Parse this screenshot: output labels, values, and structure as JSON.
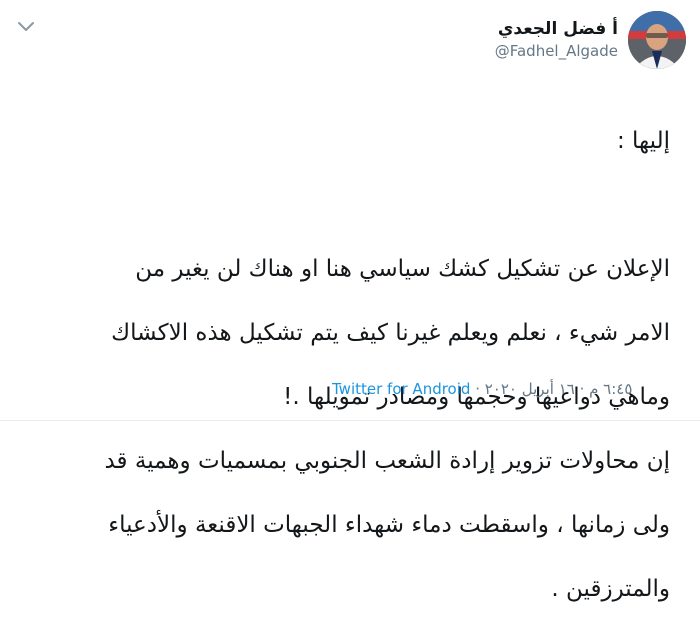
{
  "tweet": {
    "display_name": "أ فضل الجعدي",
    "handle": "@Fadhel_Algade",
    "lines": [
      "إليها :",
      "",
      "الإعلان عن تشكيل كشك سياسي هنا او هناك لن يغير من",
      "الامر شيء ، نعلم ويعلم غيرنا كيف يتم تشكيل هذه الاكشاك",
      "وماهي دواعيها وحجمها ومصادر تمويلها .!",
      "إن محاولات تزوير إرادة الشعب الجنوبي بمسميات وهمية قد",
      "ولى زمانها ، واسقطت دماء شهداء الجبهات الاقنعة والأدعياء",
      "والمترزقين ."
    ],
    "timestamp": "٦:٤٥ م · ١٦ أبريل ٢٠٢٠",
    "separator": " · ",
    "source": "Twitter for Android"
  }
}
